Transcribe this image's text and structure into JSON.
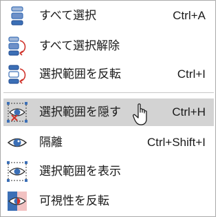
{
  "menu": {
    "items": [
      {
        "label": "すべて選択",
        "shortcut": "Ctrl+A",
        "icon": "select-all-icon"
      },
      {
        "label": "すべて選択解除",
        "shortcut": "",
        "icon": "deselect-all-icon"
      },
      {
        "label": "選択範囲を反転",
        "shortcut": "Ctrl+I",
        "icon": "invert-selection-icon"
      },
      {
        "label": "選択範囲を隠す",
        "shortcut": "Ctrl+H",
        "icon": "hide-selection-icon",
        "highlighted": true
      },
      {
        "label": "隔離",
        "shortcut": "Ctrl+Shift+I",
        "icon": "isolate-eye-icon"
      },
      {
        "label": "選択範囲を表示",
        "shortcut": "",
        "icon": "show-selection-icon"
      },
      {
        "label": "可視性を反転",
        "shortcut": "",
        "icon": "invert-visibility-icon"
      }
    ]
  },
  "colors": {
    "highlight": "#d3d3d3",
    "accent_blue": "#3b6fb6",
    "accent_red": "#d0342c"
  }
}
